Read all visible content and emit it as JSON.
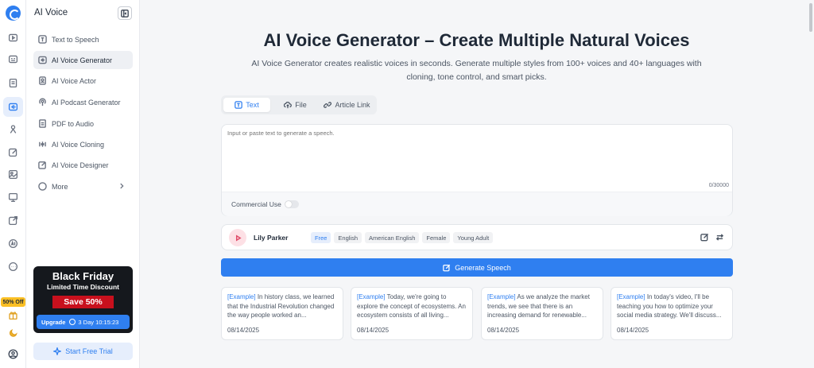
{
  "sidebar": {
    "title": "AI Voice",
    "promo_badge": "50% Off",
    "items": [
      {
        "label": "Text to Speech",
        "icon": "text-icon"
      },
      {
        "label": "AI Voice Generator",
        "icon": "voice-generator-icon",
        "active": true
      },
      {
        "label": "AI Voice Actor",
        "icon": "actor-icon"
      },
      {
        "label": "AI Podcast Generator",
        "icon": "podcast-icon"
      },
      {
        "label": "PDF to Audio",
        "icon": "pdf-icon"
      },
      {
        "label": "AI Voice Cloning",
        "icon": "cloning-icon"
      },
      {
        "label": "AI Voice Designer",
        "icon": "designer-icon"
      },
      {
        "label": "More",
        "icon": "more-icon"
      }
    ],
    "promo": {
      "title": "Black Friday",
      "subtitle": "Limited Time Discount",
      "save": "Save 50%",
      "upgrade": "Upgrade",
      "countdown": "3 Day 10:15:23"
    },
    "trial_label": "Start Free Trial"
  },
  "main": {
    "title": "AI Voice Generator – Create Multiple Natural Voices",
    "subtitle": "AI Voice Generator creates realistic voices in seconds. Generate multiple styles from 100+ voices and 40+ languages with cloning, tone control, and smart picks.",
    "tabs": [
      {
        "label": "Text",
        "active": true
      },
      {
        "label": "File"
      },
      {
        "label": "Article Link"
      }
    ],
    "input": {
      "placeholder": "Input or paste text to generate a speech.",
      "counter": "0/30000"
    },
    "commercial_label": "Commercial Use",
    "voice": {
      "name": "Lily Parker",
      "tags": [
        "Free",
        "English",
        "American English",
        "Female",
        "Young Adult"
      ]
    },
    "generate_label": "Generate Speech",
    "examples": [
      {
        "tag": "[Example]",
        "text": "In history class, we learned that the Industrial Revolution changed the way people worked an...",
        "date": "08/14/2025"
      },
      {
        "tag": "[Example]",
        "text": "Today, we're going to explore the concept of ecosystems. An ecosystem consists of all living...",
        "date": "08/14/2025"
      },
      {
        "tag": "[Example]",
        "text": "As we analyze the market trends, we see that there is an increasing demand for renewable...",
        "date": "08/14/2025"
      },
      {
        "tag": "[Example]",
        "text": "In today's video, I'll be teaching you how to optimize your social media strategy. We'll discuss...",
        "date": "08/14/2025"
      }
    ]
  },
  "colors": {
    "accent": "#2f7ff0",
    "promo_red": "#c8101d",
    "badge_yellow": "#fbbf24"
  }
}
